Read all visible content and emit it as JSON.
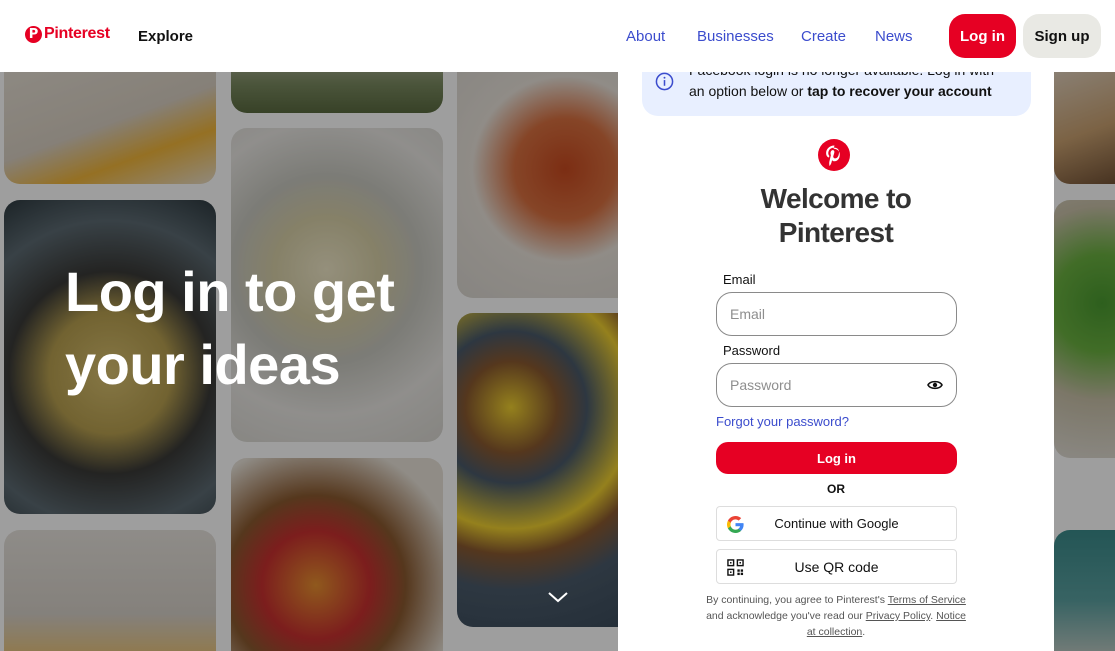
{
  "brand": {
    "name": "Pinterest",
    "accent": "#e60023",
    "link_color": "#3b4ccd"
  },
  "header": {
    "logo_text": "Pinterest",
    "explore": "Explore",
    "nav": [
      "About",
      "Businesses",
      "Create",
      "News"
    ],
    "login_label": "Log in",
    "signup_label": "Sign up"
  },
  "hero": {
    "line1": "Log in to get",
    "line2": "your ideas"
  },
  "modal": {
    "banner": {
      "line1": "Facebook login is no longer available. Log in with",
      "line2_prefix": "an option below or ",
      "line2_bold": "tap to recover your account",
      "icon": "info-icon"
    },
    "title_line1": "Welcome to",
    "title_line2": "Pinterest",
    "email": {
      "label": "Email",
      "placeholder": "Email",
      "value": ""
    },
    "password": {
      "label": "Password",
      "placeholder": "Password",
      "value": ""
    },
    "forgot": "Forgot your password?",
    "login_button": "Log in",
    "or": "OR",
    "google_button": "Continue with Google",
    "qr_button": "Use QR code",
    "legal": {
      "prefix": "By continuing, you agree to Pinterest's ",
      "terms": "Terms of Service",
      "middle": " and acknowledge you've read our ",
      "privacy": "Privacy Policy",
      "sep": ". ",
      "notice": "Notice at collection",
      "suffix": "."
    }
  }
}
